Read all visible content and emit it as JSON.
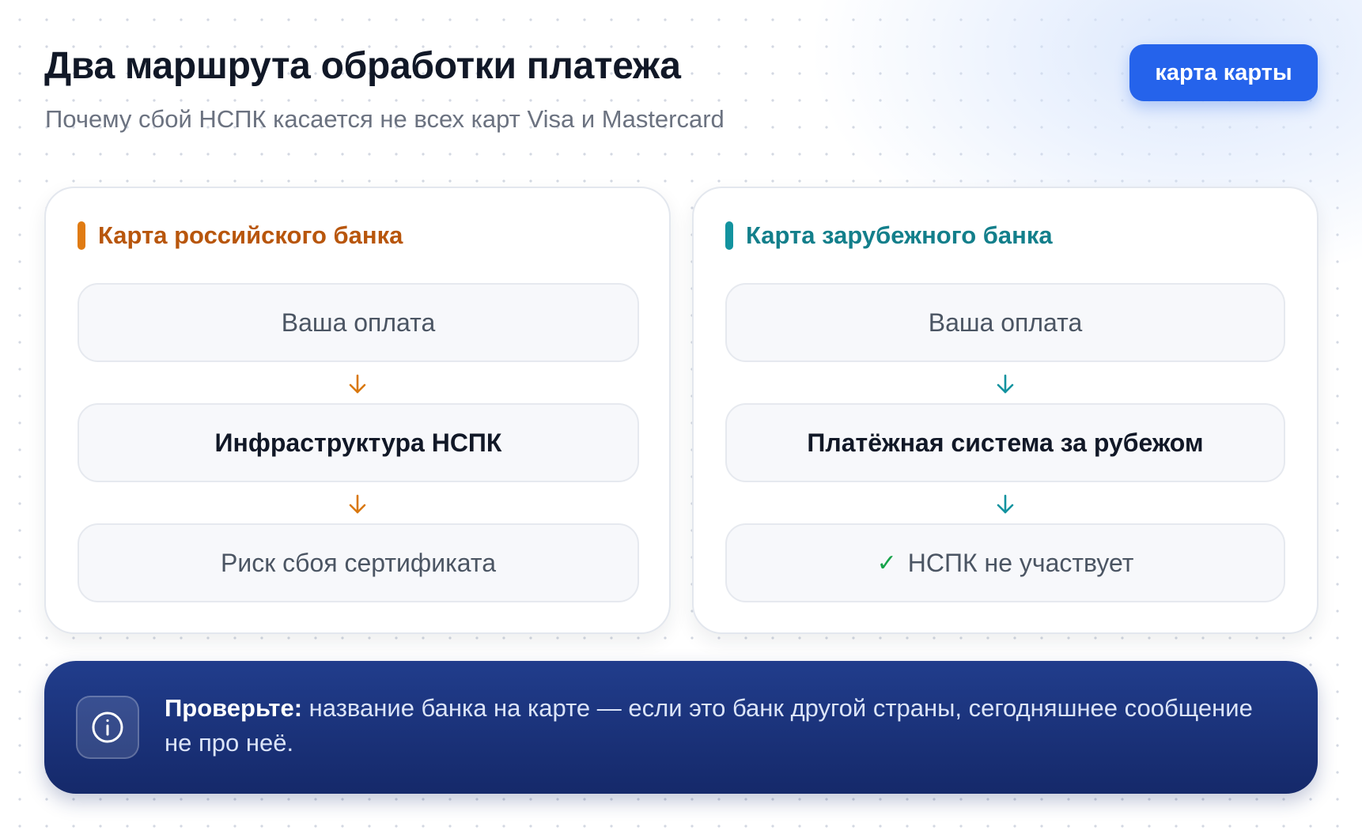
{
  "header": {
    "title": "Два маршрута обработки платежа",
    "subtitle": "Почему сбой НСПК касается не всех карт Visa и Mastercard",
    "tag_button": "карта карты"
  },
  "routes": [
    {
      "title": "Карта российского банка",
      "accent_color": "#e07b12",
      "steps": [
        "Ваша оплата",
        "Инфраструктура НСПК",
        "Риск сбоя сертификата"
      ]
    },
    {
      "title": "Карта зарубежного банка",
      "accent_color": "#13939f",
      "steps": [
        "Ваша оплата",
        "Платёжная система за рубежом",
        "НСПК не участвует"
      ],
      "final_icon": "check-icon"
    }
  ],
  "info": {
    "icon": "info-icon",
    "label": "Проверьте:",
    "text": " название банка на карте — если это банк другой страны, сегодняшнее сообщение не про неё."
  }
}
